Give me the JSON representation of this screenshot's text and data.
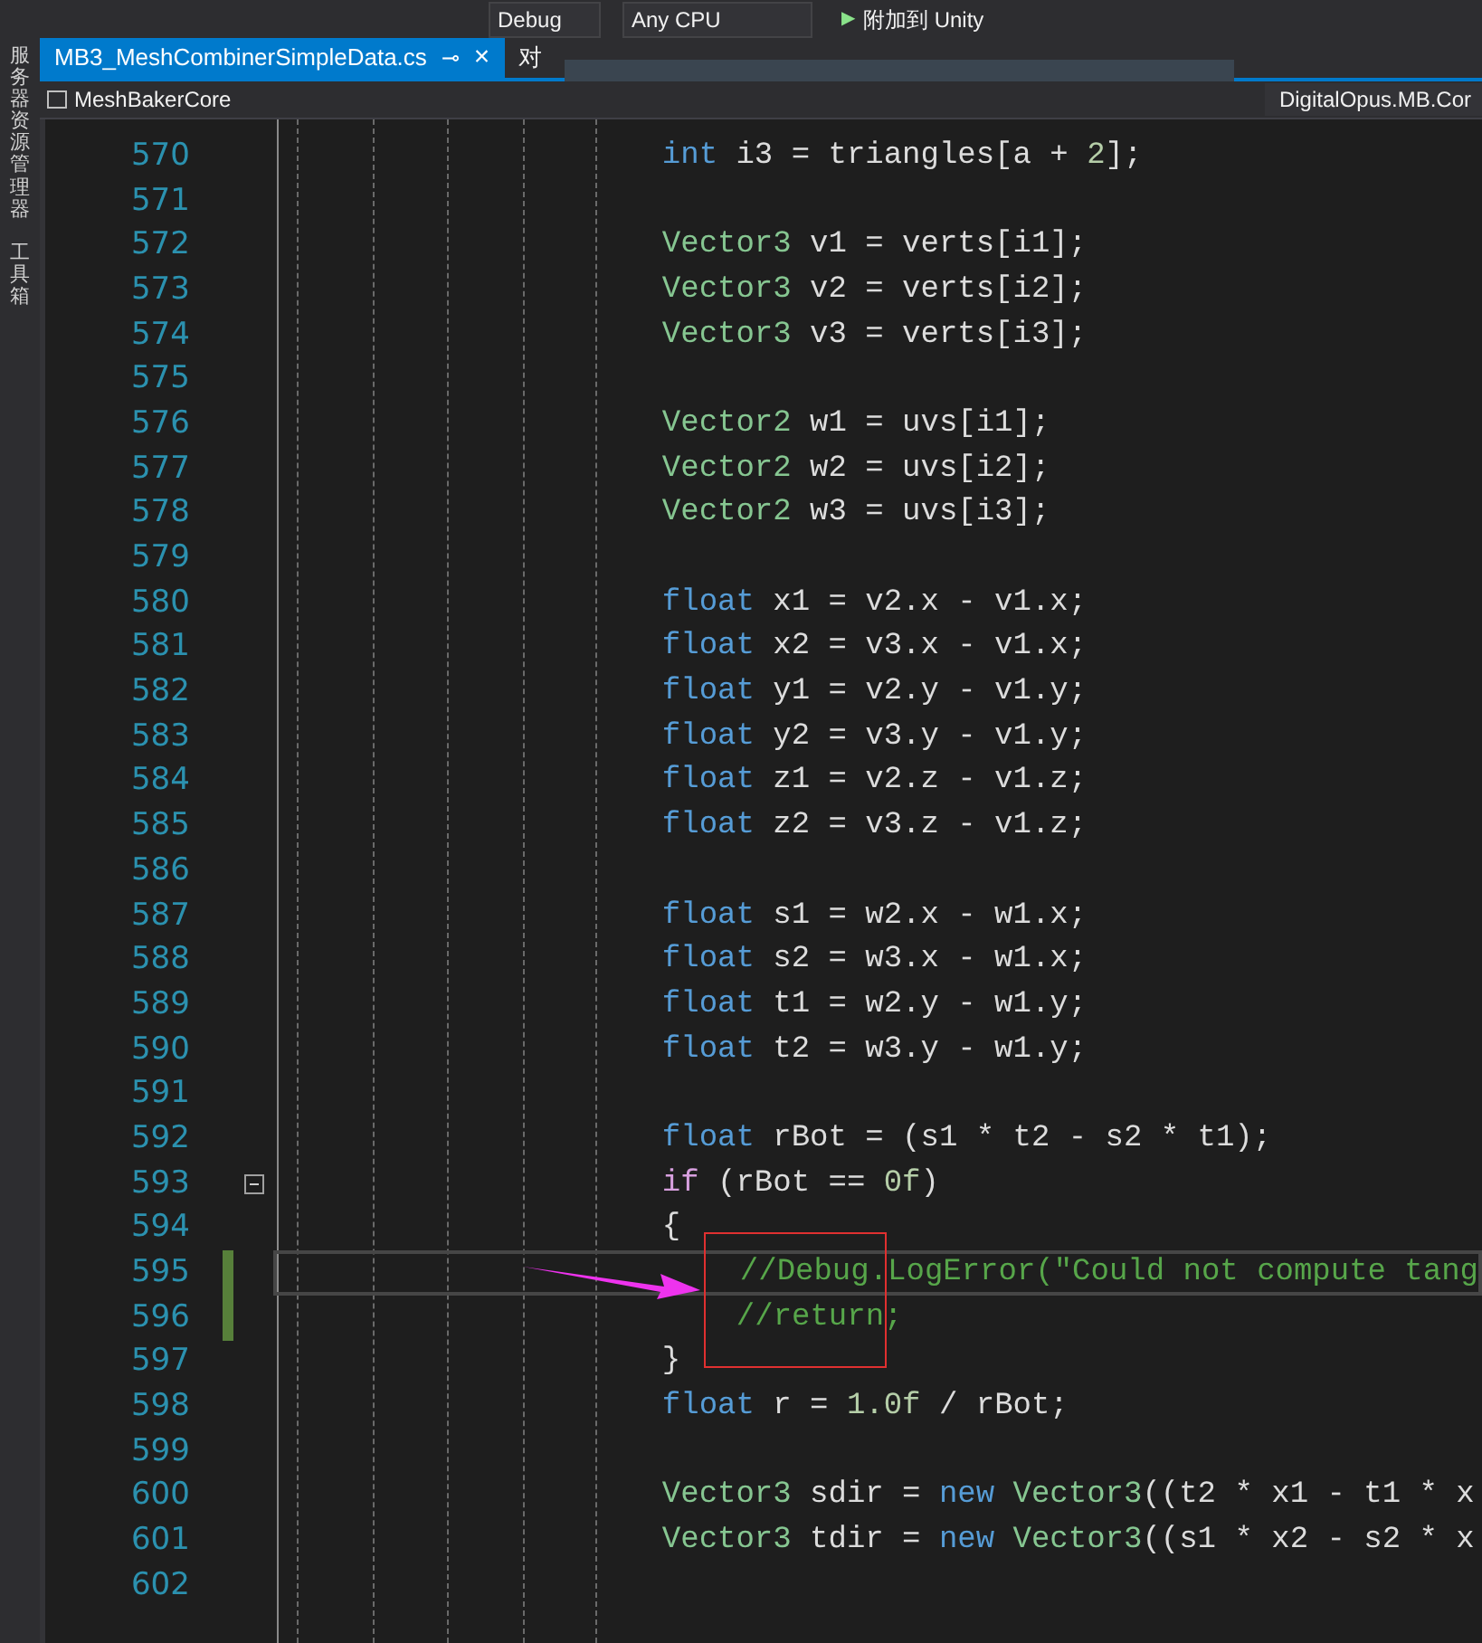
{
  "toolbar": {
    "configuration": "Debug",
    "platform": "Any CPU",
    "attach_button": "附加到 Unity",
    "attach_icon": "▶"
  },
  "side_panel": {
    "tabs": [
      {
        "label": "服务器资源管理器"
      },
      {
        "label": "工具箱"
      }
    ]
  },
  "tabs": [
    {
      "label": "MB3_MeshCombinerSimpleData.cs",
      "selected": true,
      "pin": "⊸",
      "close": "×"
    },
    {
      "label": "对",
      "selected": false
    }
  ],
  "nav_bar": {
    "project": "MeshBakerCore",
    "namespace": "DigitalOpus.MB.Cor"
  },
  "editor": {
    "lines": [
      {
        "number": "570",
        "tokens": [
          {
            "kind": "keyword",
            "text": "int"
          },
          {
            "kind": "plain",
            "text": " i3 = triangles[a + "
          },
          {
            "kind": "number",
            "text": "2"
          },
          {
            "kind": "plain",
            "text": "];"
          }
        ]
      },
      {
        "number": "571"
      },
      {
        "number": "572",
        "tokens": [
          {
            "kind": "type",
            "text": "Vector3"
          },
          {
            "kind": "plain",
            "text": " v1 = verts[i1];"
          }
        ]
      },
      {
        "number": "573",
        "tokens": [
          {
            "kind": "type",
            "text": "Vector3"
          },
          {
            "kind": "plain",
            "text": " v2 = verts[i2];"
          }
        ]
      },
      {
        "number": "574",
        "tokens": [
          {
            "kind": "type",
            "text": "Vector3"
          },
          {
            "kind": "plain",
            "text": " v3 = verts[i3];"
          }
        ]
      },
      {
        "number": "575"
      },
      {
        "number": "576",
        "tokens": [
          {
            "kind": "type",
            "text": "Vector2"
          },
          {
            "kind": "plain",
            "text": " w1 = uvs[i1];"
          }
        ]
      },
      {
        "number": "577",
        "tokens": [
          {
            "kind": "type",
            "text": "Vector2"
          },
          {
            "kind": "plain",
            "text": " w2 = uvs[i2];"
          }
        ]
      },
      {
        "number": "578",
        "tokens": [
          {
            "kind": "type",
            "text": "Vector2"
          },
          {
            "kind": "plain",
            "text": " w3 = uvs[i3];"
          }
        ]
      },
      {
        "number": "579"
      },
      {
        "number": "580",
        "tokens": [
          {
            "kind": "keyword",
            "text": "float"
          },
          {
            "kind": "plain",
            "text": " x1 = v2.x - v1.x;"
          }
        ]
      },
      {
        "number": "581",
        "tokens": [
          {
            "kind": "keyword",
            "text": "float"
          },
          {
            "kind": "plain",
            "text": " x2 = v3.x - v1.x;"
          }
        ]
      },
      {
        "number": "582",
        "tokens": [
          {
            "kind": "keyword",
            "text": "float"
          },
          {
            "kind": "plain",
            "text": " y1 = v2.y - v1.y;"
          }
        ]
      },
      {
        "number": "583",
        "tokens": [
          {
            "kind": "keyword",
            "text": "float"
          },
          {
            "kind": "plain",
            "text": " y2 = v3.y - v1.y;"
          }
        ]
      },
      {
        "number": "584",
        "tokens": [
          {
            "kind": "keyword",
            "text": "float"
          },
          {
            "kind": "plain",
            "text": " z1 = v2.z - v1.z;"
          }
        ]
      },
      {
        "number": "585",
        "tokens": [
          {
            "kind": "keyword",
            "text": "float"
          },
          {
            "kind": "plain",
            "text": " z2 = v3.z - v1.z;"
          }
        ]
      },
      {
        "number": "586"
      },
      {
        "number": "587",
        "tokens": [
          {
            "kind": "keyword",
            "text": "float"
          },
          {
            "kind": "plain",
            "text": " s1 = w2.x - w1.x;"
          }
        ]
      },
      {
        "number": "588",
        "tokens": [
          {
            "kind": "keyword",
            "text": "float"
          },
          {
            "kind": "plain",
            "text": " s2 = w3.x - w1.x;"
          }
        ]
      },
      {
        "number": "589",
        "tokens": [
          {
            "kind": "keyword",
            "text": "float"
          },
          {
            "kind": "plain",
            "text": " t1 = w2.y - w1.y;"
          }
        ]
      },
      {
        "number": "590",
        "tokens": [
          {
            "kind": "keyword",
            "text": "float"
          },
          {
            "kind": "plain",
            "text": " t2 = w3.y - w1.y;"
          }
        ]
      },
      {
        "number": "591"
      },
      {
        "number": "592",
        "tokens": [
          {
            "kind": "keyword",
            "text": "float"
          },
          {
            "kind": "plain",
            "text": " rBot = (s1 * t2 - s2 * t1);"
          }
        ]
      },
      {
        "number": "593",
        "expanded": true,
        "tokens": [
          {
            "kind": "control",
            "text": "if"
          },
          {
            "kind": "plain",
            "text": " (rBot == "
          },
          {
            "kind": "number",
            "text": "0f"
          },
          {
            "kind": "plain",
            "text": ")"
          }
        ]
      },
      {
        "number": "594",
        "tokens": [
          {
            "kind": "plain",
            "text": "{"
          }
        ]
      },
      {
        "number": "595",
        "current": true,
        "modified": true,
        "indented": true,
        "tokens": [
          {
            "kind": "comment",
            "text": "//Debug.LogError(\"Could not compute tang"
          }
        ]
      },
      {
        "number": "596",
        "modified": true,
        "indented": true,
        "tokens": [
          {
            "kind": "comment",
            "text": "//return;"
          }
        ]
      },
      {
        "number": "597",
        "tokens": [
          {
            "kind": "plain",
            "text": "}"
          }
        ]
      },
      {
        "number": "598",
        "tokens": [
          {
            "kind": "keyword",
            "text": "float"
          },
          {
            "kind": "plain",
            "text": " r = "
          },
          {
            "kind": "number",
            "text": "1.0f"
          },
          {
            "kind": "plain",
            "text": " / rBot;"
          }
        ]
      },
      {
        "number": "599"
      },
      {
        "number": "600",
        "tokens": [
          {
            "kind": "type",
            "text": "Vector3"
          },
          {
            "kind": "plain",
            "text": " sdir = "
          },
          {
            "kind": "keyword",
            "text": "new"
          },
          {
            "kind": "type",
            "text": " Vector3"
          },
          {
            "kind": "plain",
            "text": "((t2 * x1 - t1 * x"
          }
        ]
      },
      {
        "number": "601",
        "tokens": [
          {
            "kind": "type",
            "text": "Vector3"
          },
          {
            "kind": "plain",
            "text": " tdir = "
          },
          {
            "kind": "keyword",
            "text": "new"
          },
          {
            "kind": "type",
            "text": " Vector3"
          },
          {
            "kind": "plain",
            "text": "((s1 * x2 - s2 * x"
          }
        ]
      },
      {
        "number": "602"
      }
    ]
  }
}
